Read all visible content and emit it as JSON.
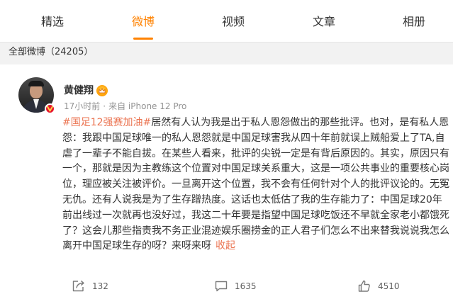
{
  "tabs": [
    {
      "label": "精选",
      "active": false
    },
    {
      "label": "微博",
      "active": true
    },
    {
      "label": "视频",
      "active": false
    },
    {
      "label": "文章",
      "active": false
    },
    {
      "label": "相册",
      "active": false
    }
  ],
  "colors": {
    "accent": "#ff8200",
    "link": "#eb7350",
    "verified": "#e6162d"
  },
  "weibo_count": {
    "label": "全部微博",
    "value": "（24205）"
  },
  "post": {
    "author": "黄健翔",
    "time": "17小时前",
    "source": "来自 iPhone 12 Pro",
    "hashtag": "#国足12强赛加油#",
    "body": "居然有人认为我是出于私人恩怨做出的那些批评。也对，是有私人恩怨：我跟中国足球唯一的私人恩怨就是中国足球害我从四十年前就误上贼船爱上了TA,自虐了一辈子不能自拔。在某些人看来，批评的尖锐一定是有背后原因的。其实，原因只有一个，那就是因为主教练这个位置对中国足球关系重大，这是一项公共事业的重要核心岗位，理应被关注被评价。一旦离开这个位置，我不会有任何针对个人的批评议论的。无冤无仇。还有人说我是为了生存蹭热度。这话也太低估了我的生存能力了：中国足球20年前出线过一次就再也没好过，我这二十年要是指望中国足球吃饭还不早就全家老小都饿死了？这会儿那些指责我不务正业混迹娱乐圈捞金的正人君子们怎么不出来替我说说我怎么离开中国足球生存的呀？来呀来呀",
    "collapse": "收起",
    "reposts": "132",
    "comments": "1635",
    "likes": "4510",
    "icons": {
      "verified": "verified-v-icon",
      "vip": "vip-crown-icon",
      "repost": "repost-icon",
      "comment": "comment-icon",
      "like": "thumbs-up-icon"
    }
  }
}
